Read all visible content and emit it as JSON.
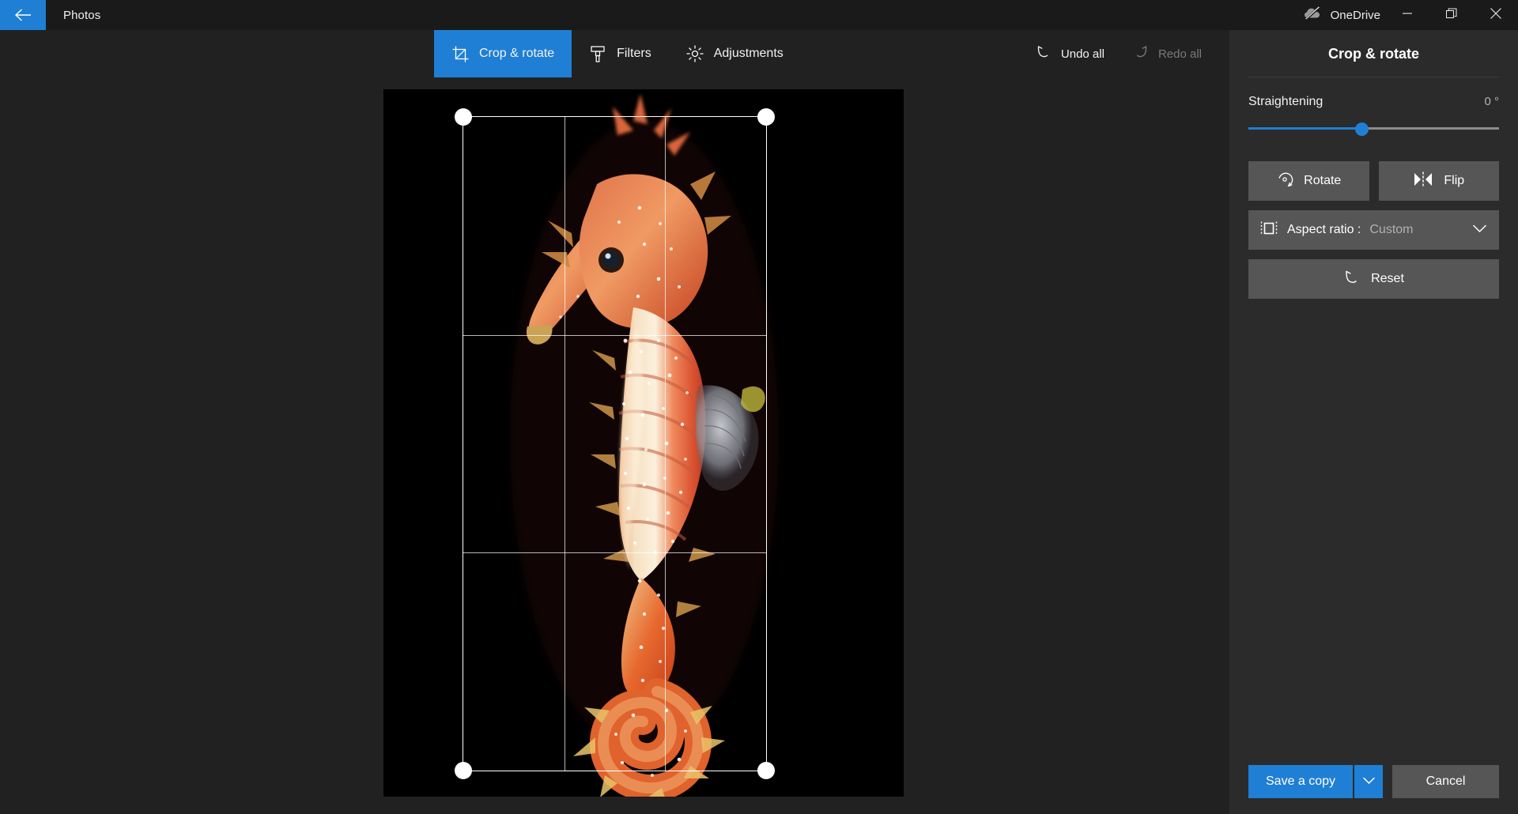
{
  "titlebar": {
    "back_icon": "arrow-left-icon",
    "app_title": "Photos",
    "onedrive_label": "OneDrive",
    "onedrive_icon": "cloud-paused-icon",
    "minimize_label": "minimize-icon",
    "restore_label": "restore-icon",
    "close_label": "close-icon"
  },
  "toolbar": {
    "tabs": [
      {
        "label": "Crop & rotate",
        "icon": "crop-icon",
        "active": true
      },
      {
        "label": "Filters",
        "icon": "filter-brush-icon",
        "active": false
      },
      {
        "label": "Adjustments",
        "icon": "brightness-icon",
        "active": false
      }
    ],
    "undo_label": "Undo all",
    "undo_icon": "undo-icon",
    "redo_label": "Redo all",
    "redo_icon": "redo-icon",
    "redo_disabled": true
  },
  "panel": {
    "title": "Crop & rotate",
    "straightening": {
      "label": "Straightening",
      "value": "0 °",
      "percent": 45
    },
    "rotate": {
      "label": "Rotate",
      "icon": "rotate-icon"
    },
    "flip": {
      "label": "Flip",
      "icon": "flip-icon"
    },
    "aspect": {
      "icon": "aspect-ratio-icon",
      "label": "Aspect ratio :",
      "value": "Custom",
      "chevron": "chevron-down-icon"
    },
    "reset": {
      "label": "Reset",
      "icon": "reset-undo-icon"
    },
    "save": {
      "label": "Save a copy",
      "chevron": "chevron-down-icon"
    },
    "cancel": {
      "label": "Cancel"
    }
  },
  "canvas": {
    "subject": "seahorse-photo",
    "crop_handles": [
      "top-left",
      "top-right",
      "bottom-left",
      "bottom-right"
    ],
    "grid": "rule-of-thirds"
  },
  "colors": {
    "accent": "#1f7fd4",
    "app_bg": "#212121",
    "titlebar_bg": "#1a1a1a",
    "panel_bg": "#2b2b2b",
    "button_bg": "#565656",
    "stage_bg": "#1f1f1f",
    "text": "#f2f2f2",
    "text_muted": "#b0b0b0",
    "text_disabled": "#7a7a7a"
  }
}
